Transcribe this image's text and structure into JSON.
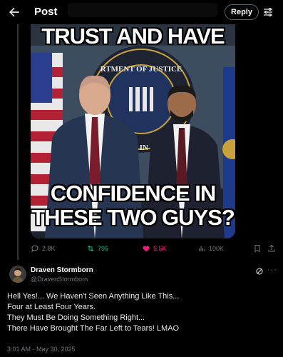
{
  "header": {
    "title": "Post",
    "reply_label": "Reply"
  },
  "media": {
    "meme_top": "TRUST AND HAVE",
    "meme_bottom_line1": "CONFIDENCE IN",
    "meme_bottom_line2": "THESE TWO GUYS?",
    "seal_text_top": "RTMENT OF JUSTICE",
    "seal_text_bottom": "OF IN"
  },
  "actions": {
    "replies": "2.8K",
    "reposts": "795",
    "likes": "5.5K",
    "views": "100K"
  },
  "post": {
    "display_name": "Draven Stormborn",
    "handle": "@DravenStormborn",
    "lines": [
      "Hell Yes!... We Haven't Seen Anything Like This...",
      "Four at Least Four Years.",
      "They Must Be Doing Something Right...",
      "There Have Brought The Far Left to Tears!  LMAO"
    ],
    "timestamp": "3:01 AM · May 30, 2025"
  },
  "colors": {
    "background": "#000000",
    "muted": "#71767b",
    "repost": "#00ba7c",
    "like": "#f91880"
  },
  "icons": [
    "back-arrow-icon",
    "tune-icon",
    "reply-icon",
    "repost-icon",
    "like-icon",
    "views-icon",
    "bookmark-icon",
    "share-icon",
    "grok-icon",
    "more-icon"
  ]
}
